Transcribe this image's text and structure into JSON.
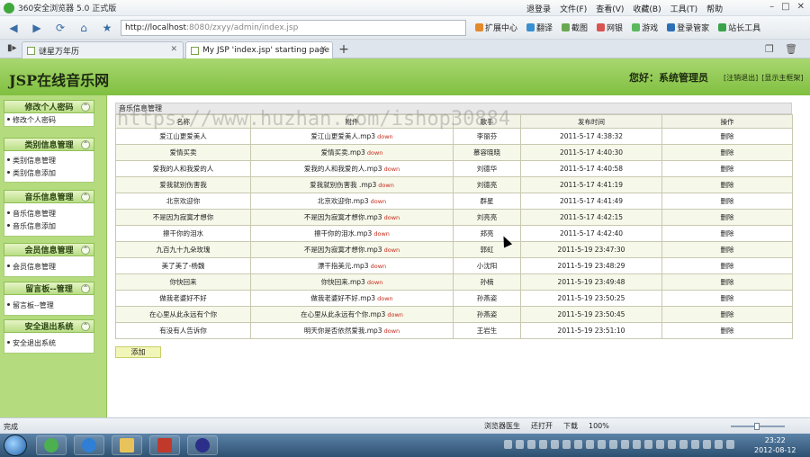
{
  "browser": {
    "title": "360安全浏览器 5.0 正式版",
    "menus": [
      "退登录",
      "文件(F)",
      "查看(V)",
      "收藏(B)",
      "工具(T)",
      "帮助"
    ],
    "url_host": "http://localhost",
    "url_rest": ":8080/zxyy/admin/index.jsp",
    "toolbar": [
      "扩展中心",
      "翻译",
      "截图",
      "网银",
      "游戏",
      "登录管家",
      "站长工具"
    ],
    "tabs": [
      {
        "label": "谜星万年历",
        "active": false
      },
      {
        "label": "My JSP 'index.jsp' starting page",
        "active": true
      }
    ],
    "status_text": "完成",
    "status_items": [
      "浏览器医生",
      "还打开",
      "下载",
      "100%"
    ]
  },
  "header": {
    "site_title": "JSP在线音乐网",
    "greeting": "您好：系统管理员",
    "links": [
      "[注销退出]",
      "[显示主框架]"
    ]
  },
  "sidebar": {
    "groups": [
      {
        "title": "修改个人密码",
        "items": [
          "修改个人密码"
        ]
      },
      {
        "title": "类别信息管理",
        "items": [
          "类别信息管理",
          "类别信息添加"
        ]
      },
      {
        "title": "音乐信息管理",
        "items": [
          "音乐信息管理",
          "音乐信息添加"
        ]
      },
      {
        "title": "会员信息管理",
        "items": [
          "会员信息管理"
        ]
      },
      {
        "title": "留言板--管理",
        "items": [
          "留言板--管理"
        ]
      },
      {
        "title": "安全退出系统",
        "items": [
          "安全退出系统"
        ]
      }
    ]
  },
  "main": {
    "panel_title": "音乐信息管理",
    "columns": [
      "名称",
      "附件",
      "歌手",
      "发布时间",
      "操作"
    ],
    "download_label": "down",
    "delete_label": "删除",
    "add_label": "添加",
    "rows": [
      {
        "name": "爱江山更爱美人",
        "file": "爱江山更爱美人.mp3",
        "singer": "李丽芬",
        "time": "2011-5-17 4:38:32"
      },
      {
        "name": "爱情买卖",
        "file": "爱情买卖.mp3",
        "singer": "慕容晓晓",
        "time": "2011-5-17 4:40:30"
      },
      {
        "name": "爱我的人和我爱的人",
        "file": "爱我的人和我爱的人.mp3",
        "singer": "刘德华",
        "time": "2011-5-17 4:40:58"
      },
      {
        "name": "爱我就别伤害我",
        "file": "爱我就别伤害我 .mp3",
        "singer": "刘德亮",
        "time": "2011-5-17 4:41:19"
      },
      {
        "name": "北京欢迎你",
        "file": "北京欢迎你.mp3",
        "singer": "群星",
        "time": "2011-5-17 4:41:49"
      },
      {
        "name": "不是因为寂寞才想你",
        "file": "不是因为寂寞才想你.mp3",
        "singer": "刘亮亮",
        "time": "2011-5-17 4:42:15"
      },
      {
        "name": "擦干你的泪水",
        "file": "擦干你的泪水.mp3",
        "singer": "郑亮",
        "time": "2011-5-17 4:42:40"
      },
      {
        "name": "九百九十九朵玫瑰",
        "file": "不是因为寂寞才想你.mp3",
        "singer": "郭虹",
        "time": "2011-5-19 23:47:30"
      },
      {
        "name": "美了美了-杨魏",
        "file": "漂干指美元.mp3",
        "singer": "小沈阳",
        "time": "2011-5-19 23:48:29"
      },
      {
        "name": "你快回来",
        "file": "你快回来.mp3",
        "singer": "孙楠",
        "time": "2011-5-19 23:49:48"
      },
      {
        "name": "做我老婆好不好",
        "file": "做我老婆好不好.mp3",
        "singer": "孙燕姿",
        "time": "2011-5-19 23:50:25"
      },
      {
        "name": "在心里从此永远有个你",
        "file": "在心里从此永远有个你.mp3",
        "singer": "孙燕姿",
        "time": "2011-5-19 23:50:45"
      },
      {
        "name": "有没有人告诉你",
        "file": "明天你是否依然爱我.mp3",
        "singer": "王岩生",
        "time": "2011-5-19 23:51:10"
      }
    ]
  },
  "watermark": "https://www.huzhan.com/ishop30884",
  "clock": {
    "time": "23:22",
    "date": "2012-08-12"
  }
}
